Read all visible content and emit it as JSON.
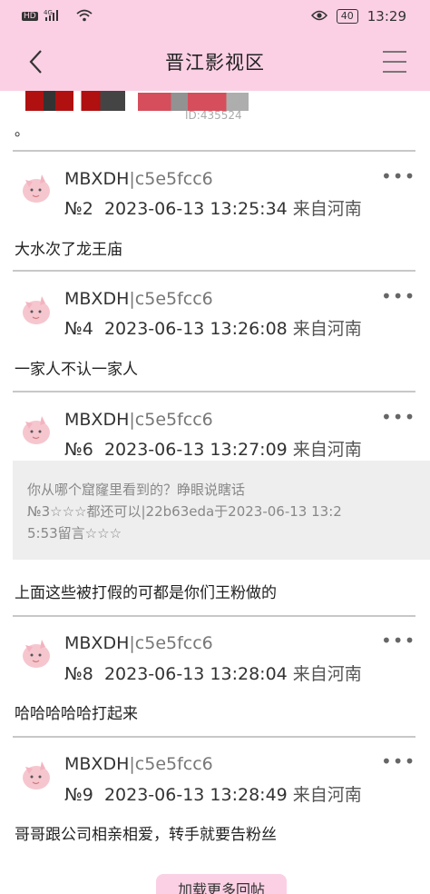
{
  "status_bar": {
    "left_icons": "HD 4G",
    "battery": "40",
    "time": "13:29"
  },
  "nav": {
    "title": "晋江影视区",
    "id_text": "ID:435524"
  },
  "intro_text": "。",
  "posts": [
    {
      "username": "MBXDH",
      "user_hash": "c5e5fcc6",
      "floor": "№2",
      "datetime": "2023-06-13 13:25:34",
      "location": "来自河南",
      "more": "•••",
      "content": "大水次了龙王庙"
    },
    {
      "username": "MBXDH",
      "user_hash": "c5e5fcc6",
      "floor": "№4",
      "datetime": "2023-06-13 13:26:08",
      "location": "来自河南",
      "more": "•••",
      "content": "一家人不认一家人"
    },
    {
      "username": "MBXDH",
      "user_hash": "c5e5fcc6",
      "floor": "№6",
      "datetime": "2023-06-13 13:27:09",
      "location": "来自河南",
      "more": "•••",
      "quote_line1": "你从哪个窟窿里看到的？睁眼说瞎话",
      "quote_line2": "№3☆☆☆都还可以|22b63eda于2023-06-13 13:2",
      "quote_line3": "5:53留言☆☆☆",
      "content": "上面这些被打假的可都是你们王粉做的"
    },
    {
      "username": "MBXDH",
      "user_hash": "c5e5fcc6",
      "floor": "№8",
      "datetime": "2023-06-13 13:28:04",
      "location": "来自河南",
      "more": "•••",
      "content": "哈哈哈哈哈打起来"
    },
    {
      "username": "MBXDH",
      "user_hash": "c5e5fcc6",
      "floor": "№9",
      "datetime": "2023-06-13 13:28:49",
      "location": "来自河南",
      "more": "•••",
      "content": "哥哥跟公司相亲相爱，转手就要告粉丝"
    }
  ],
  "load_more_label": "加载更多回帖",
  "colors": {
    "header_bg": "#fbd0e4",
    "quote_bg": "#eeeeee",
    "divider": "#c8c8c8"
  }
}
